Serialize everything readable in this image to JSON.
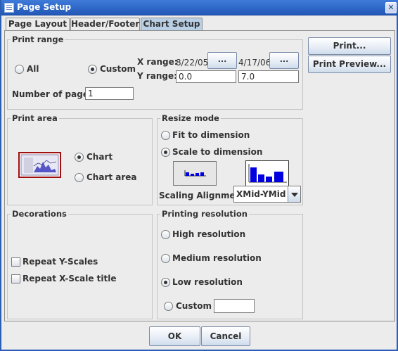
{
  "window": {
    "title": "Page Setup",
    "close_glyph": "✕"
  },
  "tabs": [
    {
      "label": "Page Layout",
      "active": false
    },
    {
      "label": "Header/Footer",
      "active": false
    },
    {
      "label": "Chart Setup",
      "active": true
    }
  ],
  "print_range": {
    "title": "Print range",
    "all_label": "All",
    "custom_label": "Custom",
    "selected": "custom",
    "x_range_label": "X range:",
    "x_start": "8/22/05",
    "x_end": "4/17/06",
    "browse_label": "...",
    "y_range_label": "Y range:",
    "y_start": "0.0",
    "y_end": "7.0",
    "pages_label": "Number of pages:",
    "pages_value": "1"
  },
  "print_area": {
    "title": "Print area",
    "chart_label": "Chart",
    "chart_area_label": "Chart area",
    "selected": "chart"
  },
  "resize_mode": {
    "title": "Resize mode",
    "fit_label": "Fit to dimension",
    "scale_label": "Scale to dimension",
    "selected": "scale",
    "alignment_label": "Scaling Alignment:",
    "alignment_value": "XMid-YMid"
  },
  "decorations": {
    "title": "Decorations",
    "repeat_y_label": "Repeat Y-Scales",
    "repeat_x_label": "Repeat X-Scale title",
    "repeat_y_checked": false,
    "repeat_x_checked": false
  },
  "printing_resolution": {
    "title": "Printing resolution",
    "high_label": "High resolution",
    "medium_label": "Medium resolution",
    "low_label": "Low resolution",
    "custom_label": "Custom",
    "custom_value": "",
    "selected": "low"
  },
  "side_buttons": {
    "print": "Print...",
    "print_preview": "Print Preview..."
  },
  "footer": {
    "ok": "OK",
    "cancel": "Cancel"
  },
  "colors": {
    "title_bar": "#2A5DB4",
    "active_tab": "#B8CFE5",
    "chart_blue": "#0000E0"
  }
}
